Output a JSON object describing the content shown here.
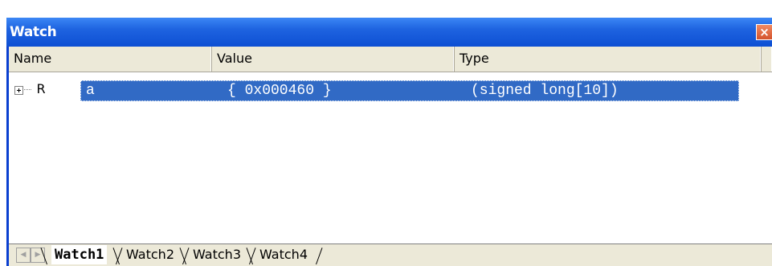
{
  "window": {
    "title": "Watch",
    "close_glyph": "×"
  },
  "columns": {
    "name": "Name",
    "value": "Value",
    "type": "Type"
  },
  "rows": [
    {
      "expander_icon": "plus-box-icon",
      "kind_icon_glyph": "R",
      "name": "a",
      "value": "{ 0x000460 }",
      "type": "(signed long[10])",
      "selected": true
    }
  ],
  "scroll": {
    "left_glyph": "◀",
    "right_glyph": "▶"
  },
  "tabs": [
    {
      "label": "Watch1",
      "active": true
    },
    {
      "label": "Watch2",
      "active": false
    },
    {
      "label": "Watch3",
      "active": false
    },
    {
      "label": "Watch4",
      "active": false
    }
  ],
  "colors": {
    "title_bar": "#0d4fd3",
    "selection": "#316ac5",
    "close_button": "#d4532c",
    "panel_bg": "#ece9d8"
  }
}
